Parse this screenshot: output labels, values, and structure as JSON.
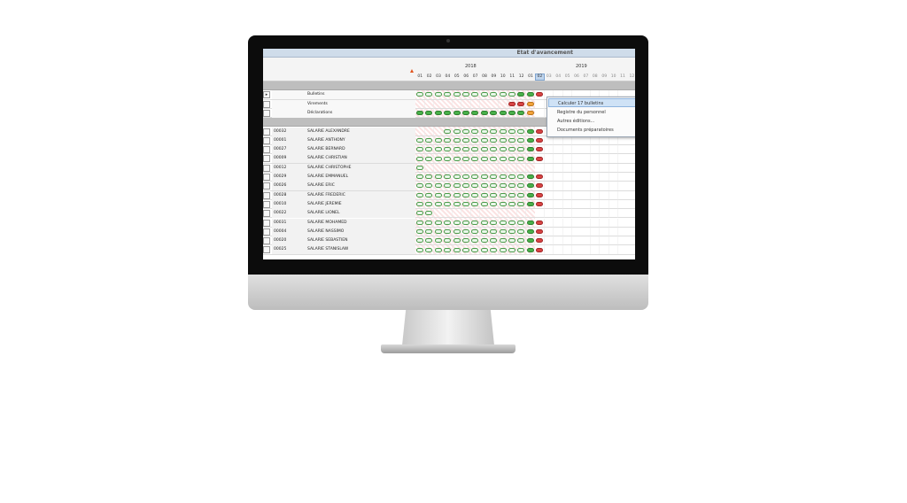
{
  "window": {
    "title": "Etat d'avancement"
  },
  "timeline": {
    "years": [
      "2018",
      "2019"
    ],
    "months_2018": [
      "01",
      "02",
      "03",
      "04",
      "05",
      "06",
      "07",
      "08",
      "09",
      "10",
      "11",
      "12"
    ],
    "months_2019": [
      "01",
      "02",
      "03",
      "04",
      "05",
      "06",
      "07",
      "08",
      "09",
      "10",
      "11",
      "12"
    ],
    "selected_month": "02"
  },
  "summary_rows": [
    {
      "label": "Bulletins"
    },
    {
      "label": "Virements"
    },
    {
      "label": "Déclarations"
    }
  ],
  "employees": [
    {
      "code": "00032",
      "name": "SALARIE ALEXANDRE"
    },
    {
      "code": "00001",
      "name": "SALARIE ANTHONY"
    },
    {
      "code": "00027",
      "name": "SALARIE BERNARD"
    },
    {
      "code": "00009",
      "name": "SALARIE CHRISTIAN"
    },
    {
      "code": "00012",
      "name": "SALARIE CHRISTOPHE"
    },
    {
      "code": "00029",
      "name": "SALARIE EMMANUEL"
    },
    {
      "code": "00026",
      "name": "SALARIE ERIC"
    },
    {
      "code": "00028",
      "name": "SALARIE FREDERIC"
    },
    {
      "code": "00010",
      "name": "SALARIE JEREMIE"
    },
    {
      "code": "00022",
      "name": "SALARIE LIONEL"
    },
    {
      "code": "00031",
      "name": "SALARIE MOHAMED"
    },
    {
      "code": "00004",
      "name": "SALARIE NASSIMO"
    },
    {
      "code": "00020",
      "name": "SALARIE SEBASTIEN"
    },
    {
      "code": "00025",
      "name": "SALARIE STANISLAW"
    }
  ],
  "context_menu": {
    "items": [
      {
        "label": "Calculer 17 bulletins"
      },
      {
        "label": "Registre du personnel"
      },
      {
        "label": "Autres éditions..."
      },
      {
        "label": "Documents préparatoires"
      }
    ]
  },
  "status_colors": {
    "done": "#49b04a",
    "error": "#d84444",
    "warning": "#f2a23a",
    "pending": "#e9f7e9"
  }
}
